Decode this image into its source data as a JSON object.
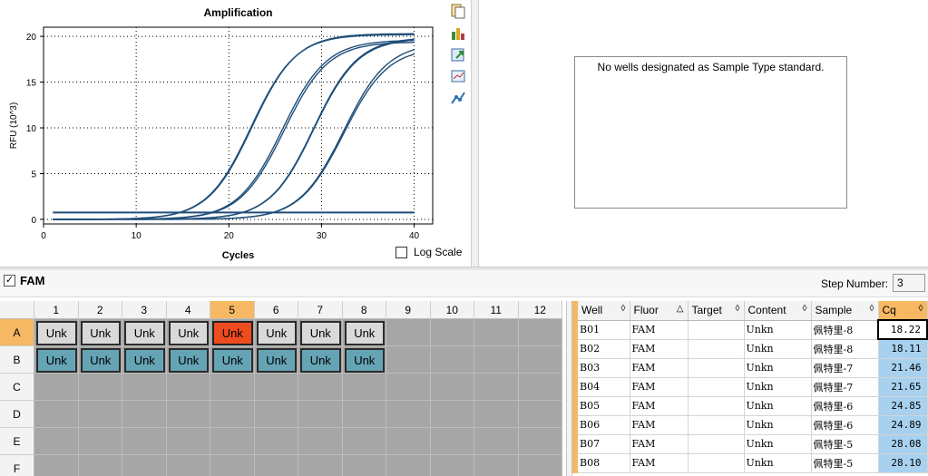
{
  "chart": {
    "log_scale_label": "Log Scale"
  },
  "chart_data": {
    "type": "line",
    "title": "Amplification",
    "xlabel": "Cycles",
    "ylabel": "RFU (10^3)",
    "xlim": [
      0,
      42
    ],
    "ylim": [
      -0.5,
      21
    ],
    "xticks": [
      0,
      10,
      20,
      30,
      40
    ],
    "yticks": [
      0,
      5,
      10,
      15,
      20
    ],
    "grid": true,
    "log_scale": false,
    "threshold": 0.75,
    "series_curves": [
      {
        "cq": 18.22,
        "plateau": 20.3
      },
      {
        "cq": 18.11,
        "plateau": 20.2
      },
      {
        "cq": 21.46,
        "plateau": 19.6
      },
      {
        "cq": 21.65,
        "plateau": 19.4
      },
      {
        "cq": 24.85,
        "plateau": 19.9
      },
      {
        "cq": 24.89,
        "plateau": 19.8
      },
      {
        "cq": 28.08,
        "plateau": 19.3
      },
      {
        "cq": 28.1,
        "plateau": 18.8
      }
    ]
  },
  "standard_curve": {
    "message": "No wells designated as Sample Type standard."
  },
  "fluor": {
    "checked": true,
    "label": "FAM"
  },
  "step": {
    "label": "Step Number:",
    "value": "3"
  },
  "plate": {
    "columns": [
      "1",
      "2",
      "3",
      "4",
      "5",
      "6",
      "7",
      "8",
      "9",
      "10",
      "11",
      "12"
    ],
    "rows": [
      "A",
      "B",
      "C",
      "D",
      "E",
      "F"
    ],
    "selected_column": "5",
    "selected_row": "A",
    "well_label": "Unk",
    "row_a_wells": [
      "Unk",
      "Unk",
      "Unk",
      "Unk",
      "Unk",
      "Unk",
      "Unk",
      "Unk"
    ],
    "row_b_wells": [
      "Unk",
      "Unk",
      "Unk",
      "Unk",
      "Unk",
      "Unk",
      "Unk",
      "Unk"
    ]
  },
  "results": {
    "headers": [
      "Well",
      "Fluor",
      "Target",
      "Content",
      "Sample",
      "Cq"
    ],
    "rows": [
      {
        "well": "B01",
        "fluor": "FAM",
        "target": "",
        "content": "Unkn",
        "sample": "佩特里-8",
        "cq": "18.22"
      },
      {
        "well": "B02",
        "fluor": "FAM",
        "target": "",
        "content": "Unkn",
        "sample": "佩特里-8",
        "cq": "18.11"
      },
      {
        "well": "B03",
        "fluor": "FAM",
        "target": "",
        "content": "Unkn",
        "sample": "佩特里-7",
        "cq": "21.46"
      },
      {
        "well": "B04",
        "fluor": "FAM",
        "target": "",
        "content": "Unkn",
        "sample": "佩特里-7",
        "cq": "21.65"
      },
      {
        "well": "B05",
        "fluor": "FAM",
        "target": "",
        "content": "Unkn",
        "sample": "佩特里-6",
        "cq": "24.85"
      },
      {
        "well": "B06",
        "fluor": "FAM",
        "target": "",
        "content": "Unkn",
        "sample": "佩特里-6",
        "cq": "24.89"
      },
      {
        "well": "B07",
        "fluor": "FAM",
        "target": "",
        "content": "Unkn",
        "sample": "佩特里-5",
        "cq": "28.08"
      },
      {
        "well": "B08",
        "fluor": "FAM",
        "target": "",
        "content": "Unkn",
        "sample": "佩特里-5",
        "cq": "28.10"
      }
    ]
  },
  "toolbar_icons": [
    "copy-icon",
    "chart-settings-icon",
    "export-icon",
    "zoom-icon",
    "trace-style-icon"
  ],
  "colors": {
    "curve": "#1f4e79",
    "selected_well": "#ee4b1f",
    "row_b_well": "#64a4b4",
    "cq_column": "#a7d1ef",
    "cq_header": "#f6b862"
  }
}
